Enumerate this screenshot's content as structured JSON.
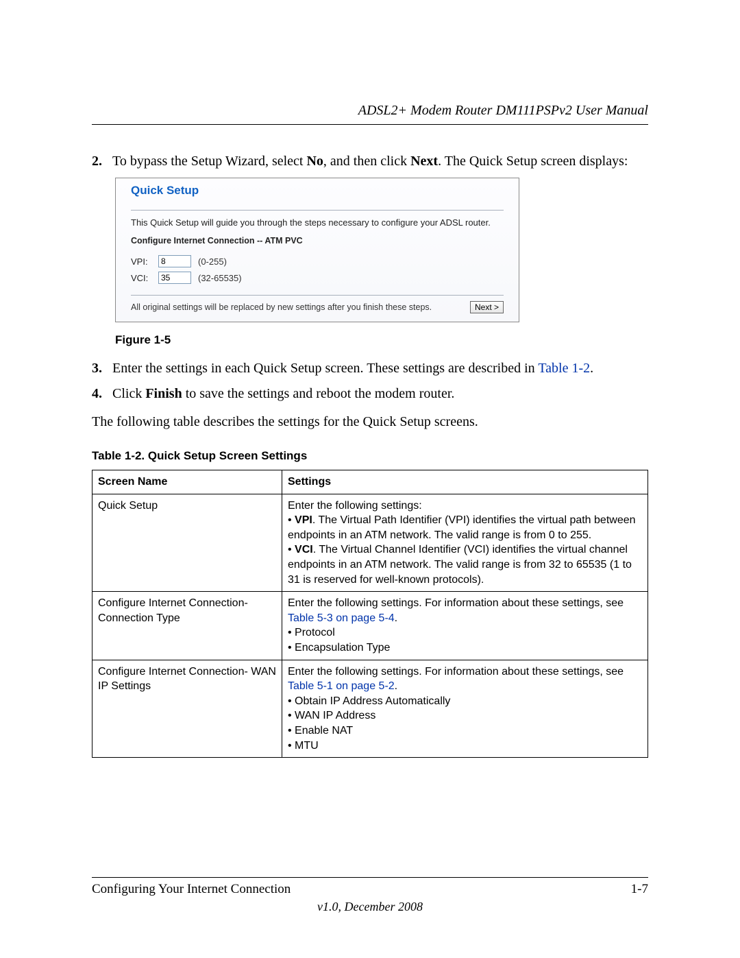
{
  "header": {
    "running_title": "ADSL2+ Modem Router DM111PSPv2 User Manual"
  },
  "steps": {
    "s2": {
      "num": "2.",
      "pre": "To bypass the Setup Wizard, select ",
      "b1": "No",
      "mid1": ", and then click ",
      "b2": "Next",
      "post": ". The Quick Setup screen displays:"
    },
    "s3": {
      "num": "3.",
      "pre": "Enter the settings in each Quick Setup screen. These settings are described in ",
      "link": "Table 1-2",
      "post": "."
    },
    "s4": {
      "num": "4.",
      "pre": "Click ",
      "b1": "Finish",
      "post": " to save the settings and reboot the modem router."
    }
  },
  "body_para": "The following table describes the settings for the Quick Setup screens.",
  "figure_caption": "Figure 1-5",
  "table_caption": "Table 1-2.   Quick Setup Screen Settings",
  "screenshot": {
    "title": "Quick Setup",
    "intro": "This Quick Setup will guide you through the steps necessary to configure your ADSL router.",
    "section_label": "Configure Internet Connection -- ATM PVC",
    "vpi_label": "VPI:",
    "vpi_value": "8",
    "vpi_range": "(0-255)",
    "vci_label": "VCI:",
    "vci_value": "35",
    "vci_range": "(32-65535)",
    "footer_note": "All original settings will be replaced by new settings after you finish these steps.",
    "next_button": "Next >"
  },
  "table": {
    "headers": {
      "col1": "Screen Name",
      "col2": "Settings"
    },
    "rows": [
      {
        "name": "Quick Setup",
        "lead": "Enter the following settings:",
        "bullets": [
          {
            "b": "VPI",
            "rest": ". The Virtual Path Identifier (VPI) identifies the virtual path between endpoints in an ATM network. The valid range is from 0 to 255."
          },
          {
            "b": "VCI",
            "rest": ". The Virtual Channel Identifier (VCI) identifies the virtual channel endpoints in an ATM network. The valid range is from 32 to 65535 (1 to 31 is reserved for well-known protocols)."
          }
        ]
      },
      {
        "name": "Configure Internet Connection- Connection Type",
        "lead": "Enter the following settings. For information about these settings, see ",
        "link": "Table 5-3 on page 5-4",
        "link_post": ".",
        "plain_bullets": [
          "Protocol",
          "Encapsulation Type"
        ]
      },
      {
        "name": "Configure Internet Connection- WAN IP Settings",
        "lead": "Enter the following settings. For information about these settings, see ",
        "link": "Table 5-1 on page 5-2",
        "link_post": ".",
        "plain_bullets": [
          "Obtain IP Address Automatically",
          "WAN IP Address",
          "Enable NAT",
          "MTU"
        ]
      }
    ]
  },
  "footer": {
    "section": "Configuring Your Internet Connection",
    "page": "1-7",
    "version": "v1.0, December 2008"
  }
}
